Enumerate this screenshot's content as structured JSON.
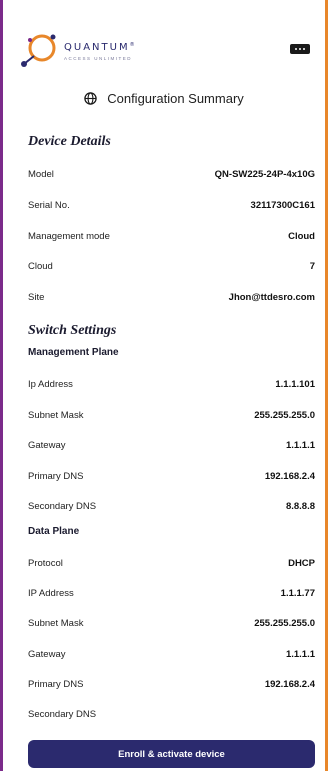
{
  "header": {
    "logo_text": "QUANTUM",
    "logo_tm": "®",
    "logo_tagline": "ACCESS UNLIMITED",
    "menu_icon": "ellipsis-icon"
  },
  "summary": {
    "title": "Configuration Summary",
    "icon": "globe-icon"
  },
  "device_details": {
    "title": "Device Details",
    "rows": [
      {
        "label": "Model",
        "value": "QN-SW225-24P-4x10G"
      },
      {
        "label": "Serial No.",
        "value": "32117300C161"
      },
      {
        "label": "Management mode",
        "value": "Cloud"
      },
      {
        "label": "Cloud",
        "value": "7"
      },
      {
        "label": "Site",
        "value": "Jhon@ttdesro.com"
      }
    ]
  },
  "switch_settings": {
    "title": "Switch Settings",
    "management_plane": {
      "title": "Management Plane",
      "rows": [
        {
          "label": "Ip Address",
          "value": "1.1.1.101"
        },
        {
          "label": "Subnet Mask",
          "value": "255.255.255.0"
        },
        {
          "label": "Gateway",
          "value": "1.1.1.1"
        },
        {
          "label": "Primary DNS",
          "value": "192.168.2.4"
        },
        {
          "label": "Secondary DNS",
          "value": "8.8.8.8"
        }
      ]
    },
    "data_plane": {
      "title": "Data Plane",
      "rows": [
        {
          "label": "Protocol",
          "value": "DHCP"
        },
        {
          "label": "IP Address",
          "value": "1.1.1.77"
        },
        {
          "label": "Subnet Mask",
          "value": "255.255.255.0"
        },
        {
          "label": "Gateway",
          "value": "1.1.1.1"
        },
        {
          "label": "Primary DNS",
          "value": "192.168.2.4"
        },
        {
          "label": "Secondary DNS",
          "value": ""
        }
      ]
    }
  },
  "actions": {
    "enroll_label": "Enroll & activate device"
  },
  "colors": {
    "brand_primary": "#2b2a6e",
    "brand_accent": "#e8872a",
    "brand_purple": "#7b2a8a"
  }
}
